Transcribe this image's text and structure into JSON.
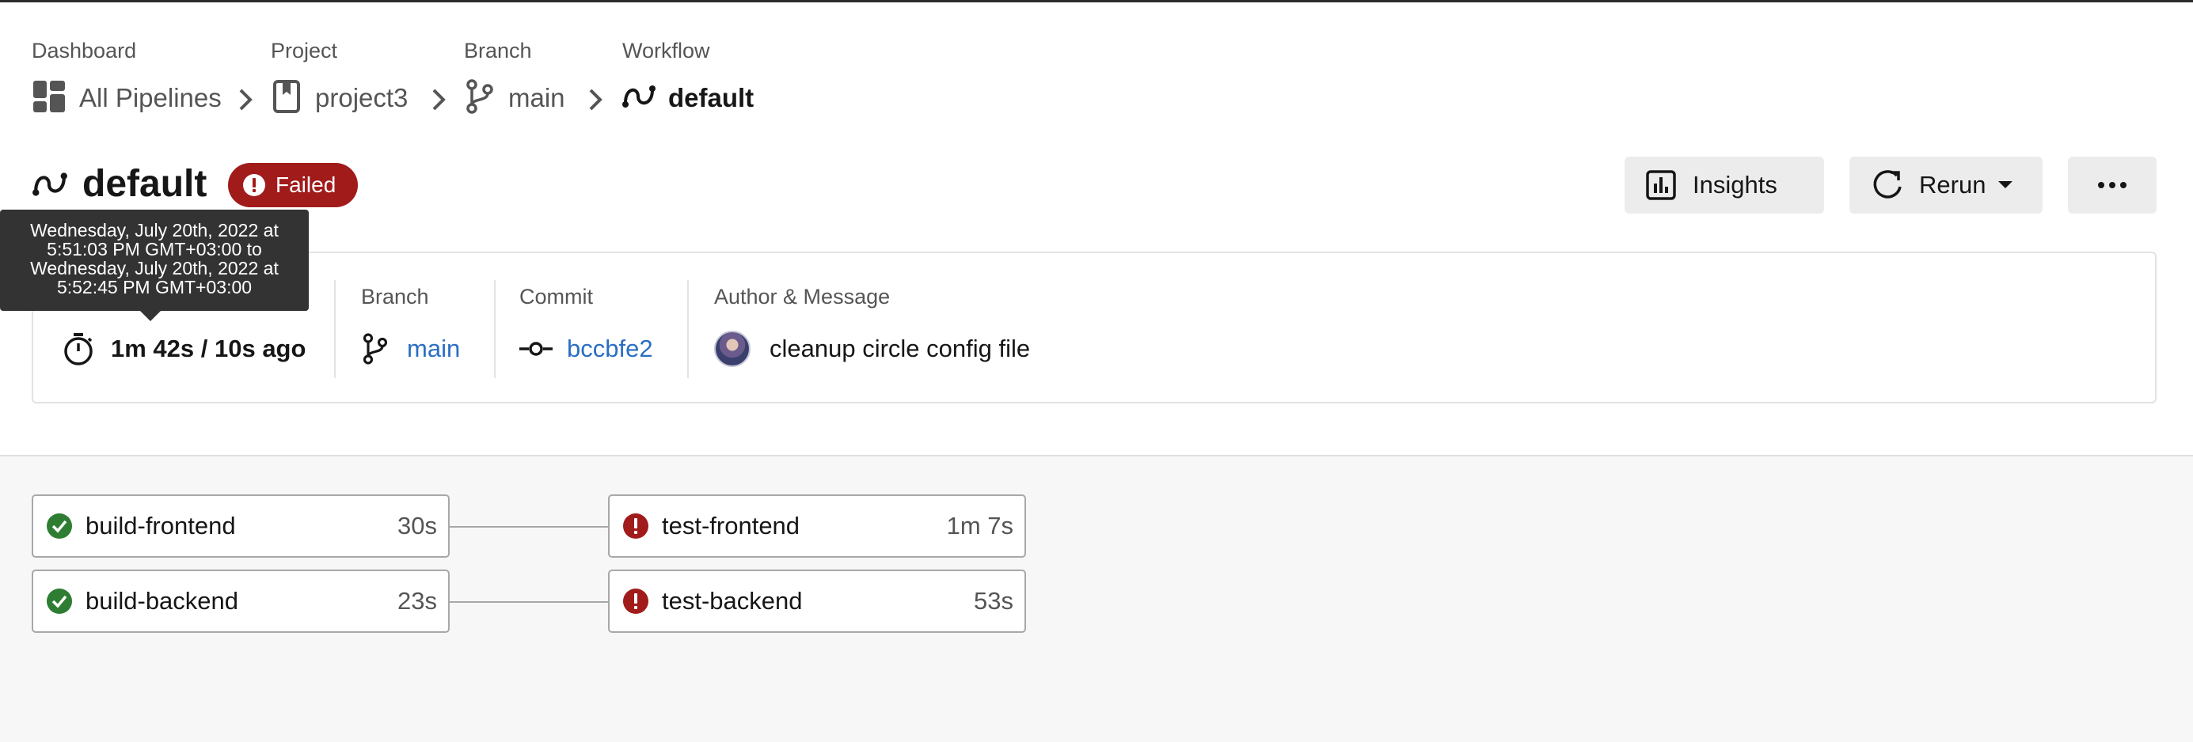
{
  "breadcrumb": {
    "dashboard": {
      "label": "Dashboard",
      "value": "All Pipelines"
    },
    "project": {
      "label": "Project",
      "value": "project3"
    },
    "branch": {
      "label": "Branch",
      "value": "main"
    },
    "workflow": {
      "label": "Workflow",
      "value": "default"
    }
  },
  "header": {
    "title": "default",
    "status": "Failed",
    "insights_label": "Insights",
    "rerun_label": "Rerun",
    "more_label": "•••"
  },
  "tooltip": {
    "text_line1": "Wednesday, July 20th, 2022 at",
    "text_line2": "5:51:03 PM GMT+03:00 to",
    "text_line3": "Wednesday, July 20th, 2022 at",
    "text_line4": "5:52:45 PM GMT+03:00"
  },
  "info": {
    "duration_value": "1m 42s / 10s ago",
    "branch_label": "Branch",
    "branch_value": "main",
    "commit_label": "Commit",
    "commit_value": "bccbfe2",
    "author_label": "Author & Message",
    "author_message": "cleanup circle config file"
  },
  "jobs": [
    {
      "name": "build-frontend",
      "duration": "30s",
      "status": "success"
    },
    {
      "name": "build-backend",
      "duration": "23s",
      "status": "success"
    },
    {
      "name": "test-frontend",
      "duration": "1m 7s",
      "status": "failed"
    },
    {
      "name": "test-backend",
      "duration": "53s",
      "status": "failed"
    }
  ],
  "colors": {
    "success": "#2e7d32",
    "failed": "#a11b1b",
    "link": "#2a6ec3"
  }
}
